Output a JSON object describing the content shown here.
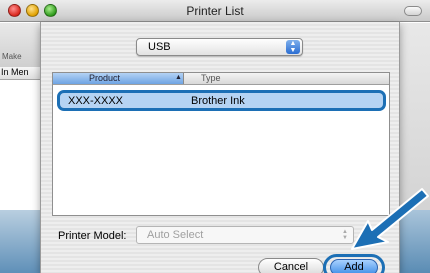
{
  "window": {
    "title": "Printer List"
  },
  "background": {
    "make_label": "Make",
    "column_label": "In Men"
  },
  "connection_popup": {
    "selected": "USB"
  },
  "printer_table": {
    "columns": [
      "Product",
      "Type"
    ],
    "rows": [
      {
        "product": "XXX-XXXX",
        "type": "Brother Ink"
      }
    ]
  },
  "printer_model": {
    "label": "Printer Model:",
    "value": "Auto Select"
  },
  "buttons": {
    "cancel": "Cancel",
    "add": "Add"
  },
  "colors": {
    "highlight": "#1c6fb5",
    "selection": "#b5d3f3",
    "accent": "#3d8ce6"
  }
}
